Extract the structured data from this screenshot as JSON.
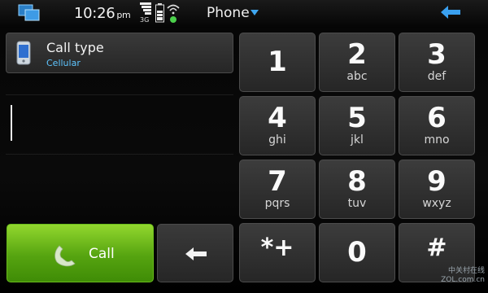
{
  "status": {
    "time": "10:26",
    "ampm": "pm",
    "network": "3G",
    "app_title": "Phone"
  },
  "call_type": {
    "title": "Call type",
    "value": "Cellular"
  },
  "call_button": {
    "label": "Call"
  },
  "keypad": {
    "k1": {
      "num": "1",
      "letters": ""
    },
    "k2": {
      "num": "2",
      "letters": "abc"
    },
    "k3": {
      "num": "3",
      "letters": "def"
    },
    "k4": {
      "num": "4",
      "letters": "ghi"
    },
    "k5": {
      "num": "5",
      "letters": "jkl"
    },
    "k6": {
      "num": "6",
      "letters": "mno"
    },
    "k7": {
      "num": "7",
      "letters": "pqrs"
    },
    "k8": {
      "num": "8",
      "letters": "tuv"
    },
    "k9": {
      "num": "9",
      "letters": "wxyz"
    },
    "kstar": {
      "num": "*+",
      "letters": ""
    },
    "k0": {
      "num": "0",
      "letters": ""
    },
    "khash": {
      "num": "#",
      "letters": ""
    }
  },
  "watermark": {
    "line1": "中关村在线",
    "line2": "ZOL.com.cn"
  },
  "colors": {
    "accent_blue": "#5ec5ff",
    "call_green": "#56a410"
  },
  "icons": [
    "task-switcher-icon",
    "signal-icon",
    "battery-icon",
    "wifi-icon",
    "dropdown-arrow-icon",
    "back-arrow-icon",
    "mobile-phone-icon",
    "handset-icon",
    "backspace-arrow-icon"
  ]
}
